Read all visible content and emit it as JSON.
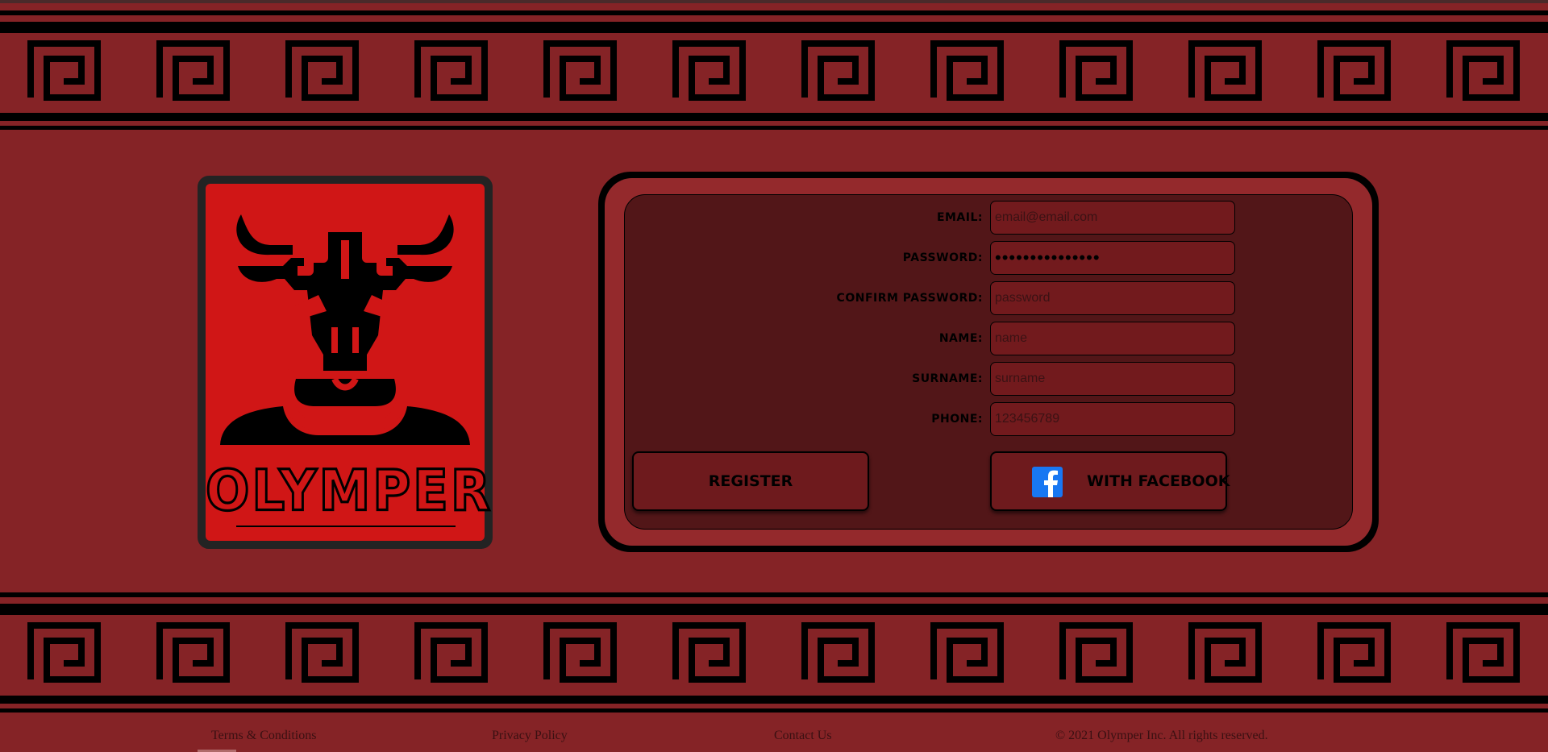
{
  "brand": {
    "name": "OLYMPER"
  },
  "form": {
    "fields": [
      {
        "label": "EMAIL:",
        "value": "",
        "placeholder": "email@email.com"
      },
      {
        "label": "PASSWORD:",
        "value": "•••••••••••••••",
        "placeholder": ""
      },
      {
        "label": "CONFIRM PASSWORD:",
        "value": "",
        "placeholder": "password"
      },
      {
        "label": "NAME:",
        "value": "",
        "placeholder": "name"
      },
      {
        "label": "SURNAME:",
        "value": "",
        "placeholder": "surname"
      },
      {
        "label": "PHONE:",
        "value": "",
        "placeholder": "123456789"
      }
    ],
    "register_label": "REGISTER",
    "facebook_label": "WITH FACEBOOK",
    "facebook_icon": "facebook-icon"
  },
  "footer": {
    "terms": "Terms & Conditions",
    "privacy": "Privacy Policy",
    "contact": "Contact Us",
    "copyright": "© 2021 Olymper Inc. All rights reserved."
  },
  "colors": {
    "background": "#852326",
    "logo_red": "#d01616",
    "panel_dark": "#521618",
    "border": "#000000",
    "facebook_blue": "#1877f2"
  }
}
